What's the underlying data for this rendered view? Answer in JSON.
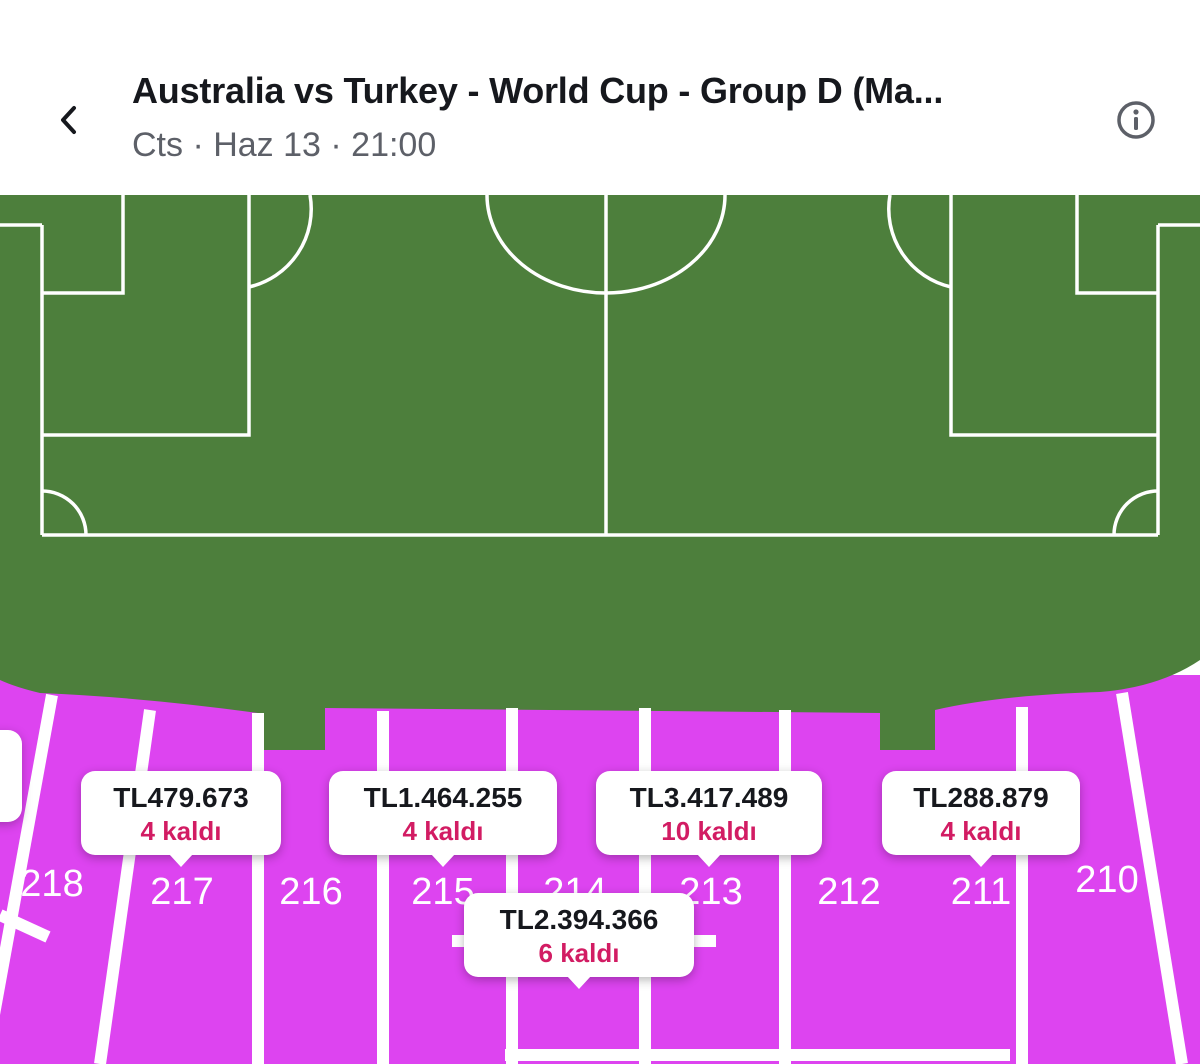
{
  "header": {
    "title": "Australia vs Turkey - World Cup - Group D (Ma...",
    "subtitle": "Cts · Haz 13 · 21:00",
    "back_icon": "chevron-left-icon",
    "info_icon": "info-icon"
  },
  "colors": {
    "pitch": "#4d7f3c",
    "section": "#dd44f0",
    "line": "#ffffff",
    "price_text": "#16181d",
    "remaining_text": "#d21c63"
  },
  "sections": [
    {
      "id": "218"
    },
    {
      "id": "217"
    },
    {
      "id": "216"
    },
    {
      "id": "215"
    },
    {
      "id": "214"
    },
    {
      "id": "213"
    },
    {
      "id": "212"
    },
    {
      "id": "211"
    },
    {
      "id": "210"
    }
  ],
  "price_pins": [
    {
      "price": "TL479.673",
      "remaining": "4 kaldı"
    },
    {
      "price": "TL1.464.255",
      "remaining": "4 kaldı"
    },
    {
      "price": "TL3.417.489",
      "remaining": "10 kaldı"
    },
    {
      "price": "TL288.879",
      "remaining": "4 kaldı"
    },
    {
      "price": "TL2.394.366",
      "remaining": "6 kaldı"
    }
  ]
}
